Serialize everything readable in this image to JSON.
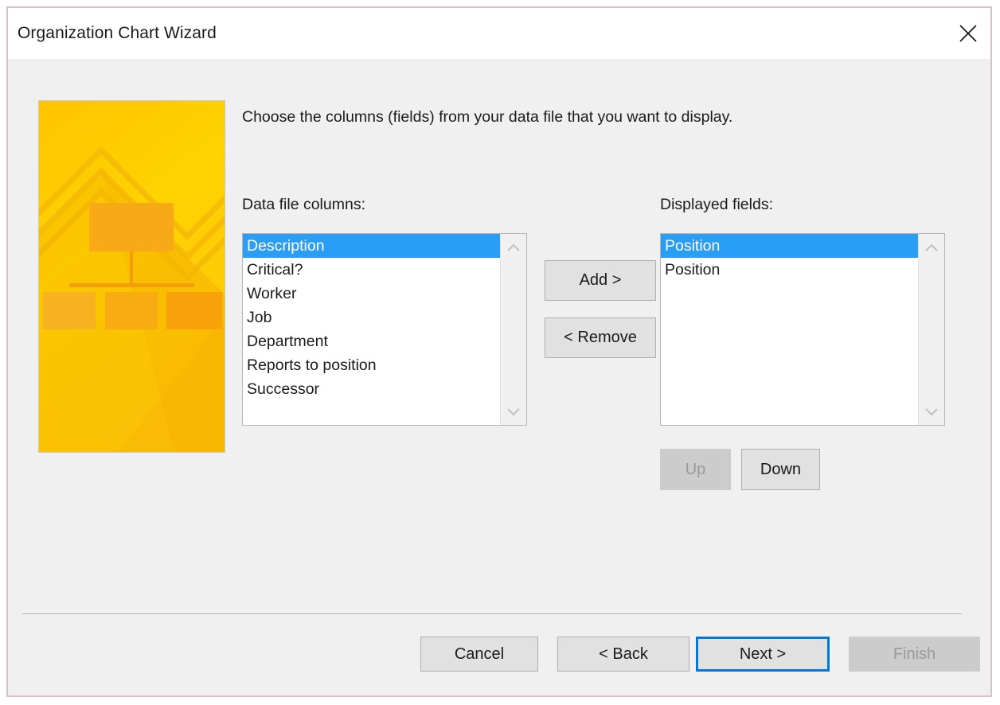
{
  "window": {
    "title": "Organization Chart Wizard",
    "close_icon": "close-icon"
  },
  "instruction": "Choose the columns (fields) from your data file that you want to display.",
  "left_panel": {
    "label": "Data file columns:",
    "items": [
      {
        "label": "Description",
        "selected": true
      },
      {
        "label": "Critical?",
        "selected": false
      },
      {
        "label": "Worker",
        "selected": false
      },
      {
        "label": "Job",
        "selected": false
      },
      {
        "label": "Department",
        "selected": false
      },
      {
        "label": "Reports to position",
        "selected": false
      },
      {
        "label": "Successor",
        "selected": false
      }
    ]
  },
  "right_panel": {
    "label": "Displayed fields:",
    "items": [
      {
        "label": "Position",
        "selected": true
      },
      {
        "label": "Position",
        "selected": false
      }
    ]
  },
  "transfer_buttons": {
    "add": "Add >",
    "remove": "< Remove"
  },
  "order_buttons": {
    "up": "Up",
    "down": "Down"
  },
  "footer_buttons": {
    "cancel": "Cancel",
    "back": "< Back",
    "next": "Next >",
    "finish": "Finish"
  },
  "scrollbar": {
    "up_arrow_icon": "chevron-up-icon",
    "down_arrow_icon": "chevron-down-icon"
  },
  "graphic": {
    "name": "org-chart-wizard-banner",
    "colors": {
      "background": "#ffc800",
      "background_alt": "#ffd400",
      "chevron": "#f5ba00",
      "box": "#f7a91b",
      "shadow": "#f0b400"
    }
  },
  "colors": {
    "window_border": "#d9c2c6",
    "titlebar": "#ffffff",
    "body": "#f0f0f0",
    "selection": "#2a9df4",
    "focus": "#0078d7",
    "button": "#e1e1e1",
    "button_disabled": "#cccccc",
    "text": "#1b1b1b",
    "text_disabled": "#9a9a9a"
  }
}
